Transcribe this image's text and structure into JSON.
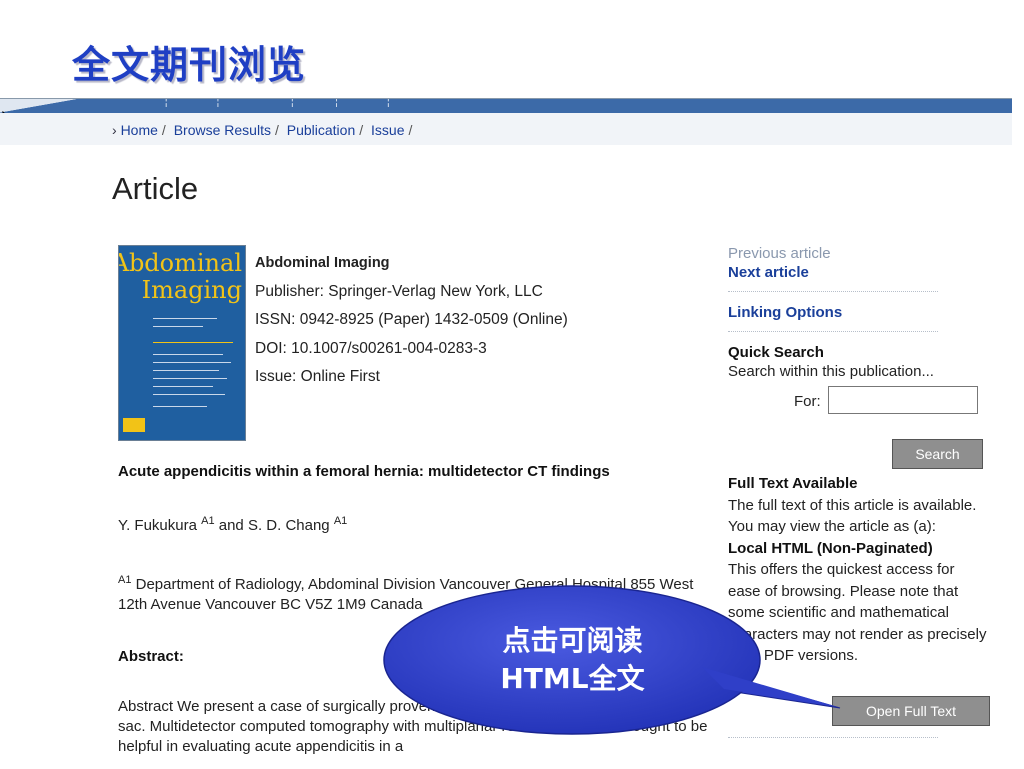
{
  "slide_title": "全文期刊浏览",
  "breadcrumb": {
    "prefix": "›",
    "items": [
      "Home",
      "Browse Results",
      "Publication",
      "Issue"
    ]
  },
  "page_heading": "Article",
  "cover": {
    "title_line1": "Abdominal",
    "title_line2": "Imaging"
  },
  "publication": {
    "name": "Abdominal Imaging",
    "publisher": "Publisher: Springer-Verlag New York, LLC",
    "issn": "ISSN: 0942-8925 (Paper) 1432-0509 (Online)",
    "doi": "DOI: 10.1007/s00261-004-0283-3",
    "issue": "Issue: Online First"
  },
  "article": {
    "title": "Acute appendicitis within a femoral hernia: multidetector CT findings",
    "author1": "Y. Fukukura ",
    "author_sep": " and S. D. Chang ",
    "affil_sup": "A1",
    "affiliation": " Department of Radiology, Abdominal Division Vancouver General Hospital 855 West 12th Avenue Vancouver BC V5Z 1M9 Canada",
    "abstract_label": "Abstract:",
    "abstract_text": "Abstract We present a case of surgically proven acute appendicitis in a femoral hernia sac. Multidetector computed tomography with multiplanar reformations was thought to be helpful in evaluating acute appendicitis in a"
  },
  "sidebar": {
    "previous": "Previous article",
    "next": "Next article",
    "linking": "Linking Options",
    "quick_search_head": "Quick Search",
    "quick_search_desc": "Search within this publication...",
    "for_label": "For:",
    "search_value": "",
    "search_button": "Search",
    "ft_head": "Full Text Available",
    "ft_desc": "The full text of this article is available. You may view the article as (a):",
    "html_head": "Local HTML (Non-Paginated)",
    "html_desc": "This offers the quickest access for ease of browsing. Please note that some scientific and mathematical characters may not render as precisely as in PDF versions.",
    "open_button": "Open Full Text"
  },
  "callout": {
    "line1": "点击可阅读",
    "line2": "HTML全文",
    "fill_color": "#2f3fc8"
  }
}
